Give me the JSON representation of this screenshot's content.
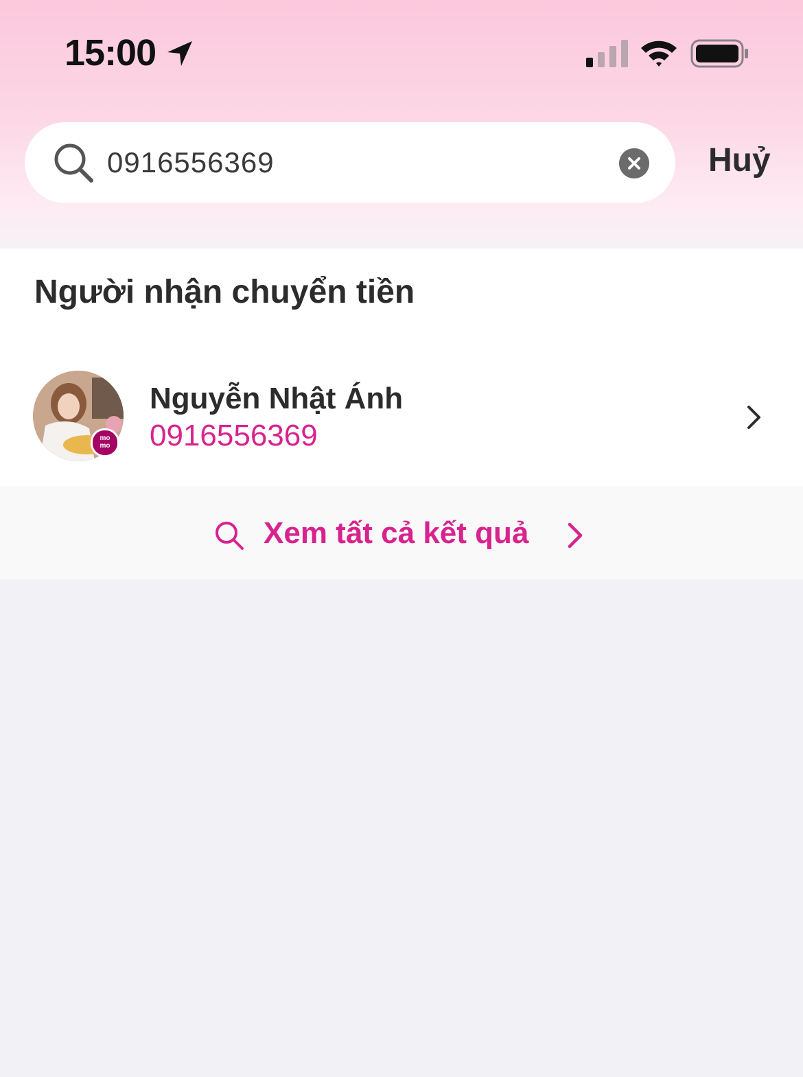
{
  "status_bar": {
    "time": "15:00",
    "icons": [
      "location-arrow-icon",
      "cellular-signal-icon",
      "wifi-icon",
      "battery-icon"
    ]
  },
  "search": {
    "value": "0916556369",
    "cancel_label": "Huỷ",
    "icons": [
      "search-icon",
      "clear-icon"
    ]
  },
  "results": {
    "section_title": "Người nhận chuyển tiền",
    "contacts": [
      {
        "name": "Nguyễn Nhật Ánh",
        "phone": "0916556369",
        "badge_top": "mo",
        "badge_bottom": "mo"
      }
    ],
    "see_all_label": "Xem tất cả kết quả"
  },
  "colors": {
    "accent": "#d8238f",
    "brand": "#a50064",
    "header_gradient_top": "#fbc8dc",
    "background": "#f2f1f6"
  }
}
